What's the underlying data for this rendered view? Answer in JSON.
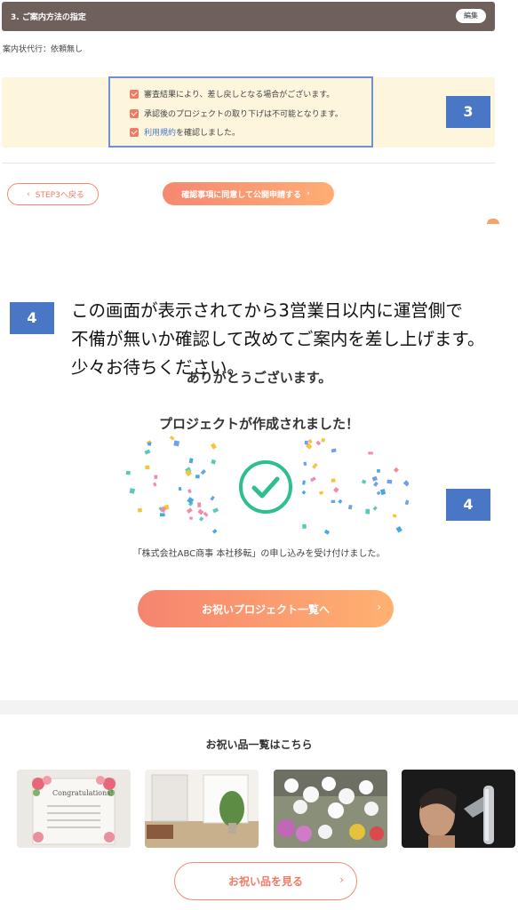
{
  "section": {
    "title": "3. ご案内方法の指定",
    "edit_label": "編集",
    "status_text": "案内状代行：依頼無し"
  },
  "terms": {
    "item1": "審査結果により、差し戻しとなる場合がございます。",
    "item2": "承認後のプロジェクトの取り下げは不可能となります。",
    "item3_link": "利用規約",
    "item3_suffix": "を確認しました。"
  },
  "badges": {
    "step3": "3",
    "step4a": "4",
    "step4b": "4"
  },
  "buttons": {
    "back": "STEP3へ戻る",
    "submit": "確認事項に同意して公開申請する",
    "gift_projects": "お祝いプロジェクト一覧へ",
    "see_gifts": "お祝い品を見る"
  },
  "notice": {
    "line1": "この画面が表示されてから3営業日以内に運営側で",
    "line2": "不備が無いか確認して改めてご案内を差し上げます。",
    "line3": "少々お待ちください。"
  },
  "completion": {
    "thanks": "ありがとうございます。",
    "created": "プロジェクトが作成されました！",
    "accepted": "「株式会社ABC商事 本社移転」の申し込みを受け付けました。"
  },
  "gifts": {
    "heading": "お祝い品一覧はこちら",
    "item1_label": "Congratulations!"
  },
  "colors": {
    "header_bg": "#6f605c",
    "accent": "#f07b64",
    "badge": "#4a76c6",
    "check_green": "#2fbf8f"
  }
}
